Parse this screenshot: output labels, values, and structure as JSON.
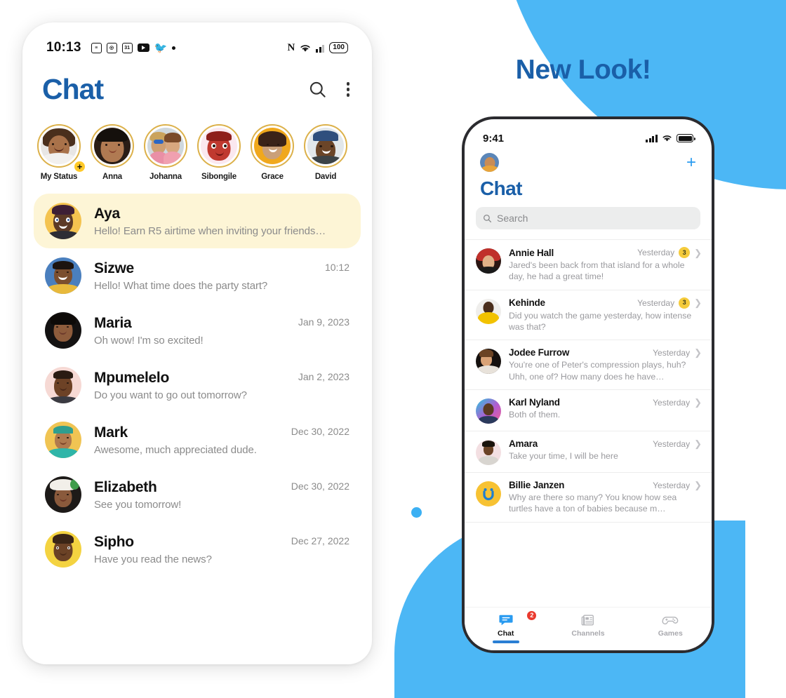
{
  "promo": {
    "headline": "New Look!",
    "accent_blue": "#1a5fa8",
    "bg_blue": "#4cb7f5"
  },
  "android": {
    "status_bar": {
      "time": "10:13",
      "battery": "100",
      "icons": [
        "messages-icon",
        "camera-icon",
        "calendar-icon",
        "youtube-icon",
        "twitter-icon",
        "dot-icon"
      ],
      "right_icons": [
        "nfc-icon",
        "wifi-icon",
        "signal-icon",
        "battery-icon"
      ]
    },
    "header": {
      "title": "Chat",
      "search_icon": "search-icon",
      "menu_icon": "overflow-menu-icon"
    },
    "stories": [
      {
        "name": "My Status",
        "has_add": true
      },
      {
        "name": "Anna",
        "has_add": false
      },
      {
        "name": "Johanna",
        "has_add": false
      },
      {
        "name": "Sibongile",
        "has_add": false
      },
      {
        "name": "Grace",
        "has_add": false
      },
      {
        "name": "David",
        "has_add": false
      }
    ],
    "chats": [
      {
        "name": "Aya",
        "message": "Hello! Earn R5 airtime when inviting your friends…",
        "time": "",
        "highlight": true
      },
      {
        "name": "Sizwe",
        "message": "Hello! What time does the party start?",
        "time": "10:12",
        "highlight": false
      },
      {
        "name": "Maria",
        "message": "Oh wow! I'm so excited!",
        "time": "Jan 9, 2023",
        "highlight": false
      },
      {
        "name": "Mpumelelo",
        "message": "Do you want to go out tomorrow?",
        "time": "Jan 2, 2023",
        "highlight": false
      },
      {
        "name": "Mark",
        "message": "Awesome, much appreciated dude.",
        "time": "Dec 30, 2022",
        "highlight": false
      },
      {
        "name": "Elizabeth",
        "message": "See you tomorrow!",
        "time": "Dec 30, 2022",
        "highlight": false
      },
      {
        "name": "Sipho",
        "message": "Have you read the news?",
        "time": "Dec 27, 2022",
        "highlight": false
      }
    ]
  },
  "ios": {
    "status_bar": {
      "time": "9:41"
    },
    "topbar": {
      "avatar": "profile-avatar",
      "add_label": "+"
    },
    "title": "Chat",
    "search": {
      "placeholder": "Search",
      "icon": "search-icon"
    },
    "chats": [
      {
        "name": "Annie Hall",
        "date": "Yesterday",
        "badge": "3",
        "preview": "Jared's been back from that island for a whole day, he had a great time!"
      },
      {
        "name": "Kehinde",
        "date": "Yesterday",
        "badge": "3",
        "preview": "Did you watch the game yesterday, how intense was that?"
      },
      {
        "name": "Jodee Furrow",
        "date": "Yesterday",
        "badge": "",
        "preview": "You're one of Peter's compression plays, huh? Uhh, one of? How many does he have…"
      },
      {
        "name": "Karl Nyland",
        "date": "Yesterday",
        "badge": "",
        "preview": "Both of them."
      },
      {
        "name": "Amara",
        "date": "Yesterday",
        "badge": "",
        "preview": "Take your time, I will be here"
      },
      {
        "name": "Billie Janzen",
        "date": "Yesterday",
        "badge": "",
        "preview": "Why are there so many? You know how sea turtles have a ton of babies because m…"
      }
    ],
    "tabs": [
      {
        "label": "Chat",
        "icon": "chat-bubble-icon",
        "active": true,
        "badge": "2"
      },
      {
        "label": "Channels",
        "icon": "newspaper-icon",
        "active": false,
        "badge": ""
      },
      {
        "label": "Games",
        "icon": "gamepad-icon",
        "active": false,
        "badge": ""
      }
    ]
  }
}
